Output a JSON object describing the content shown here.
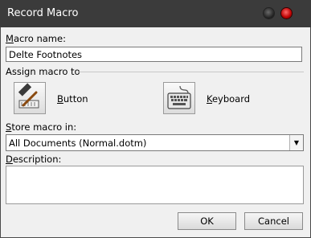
{
  "window": {
    "title": "Record Macro"
  },
  "macro_name": {
    "label_first": "M",
    "label_rest": "acro name:",
    "value": "Delte Footnotes"
  },
  "assign": {
    "label": "Assign macro to"
  },
  "button_option": {
    "label_first": "B",
    "label_rest": "utton",
    "icon": "hammer-icon"
  },
  "keyboard_option": {
    "label_first": "K",
    "label_rest": "eyboard",
    "icon": "keyboard-icon"
  },
  "store": {
    "label_first": "S",
    "label_rest": "tore macro in:",
    "value": "All Documents (Normal.dotm)"
  },
  "description": {
    "label_first": "D",
    "label_rest": "escription:",
    "value": ""
  },
  "buttons": {
    "ok": "OK",
    "cancel": "Cancel"
  },
  "colors": {
    "titlebar": "#3b3b3b",
    "client": "#f0f0f0",
    "close_button": "#cc0000"
  }
}
